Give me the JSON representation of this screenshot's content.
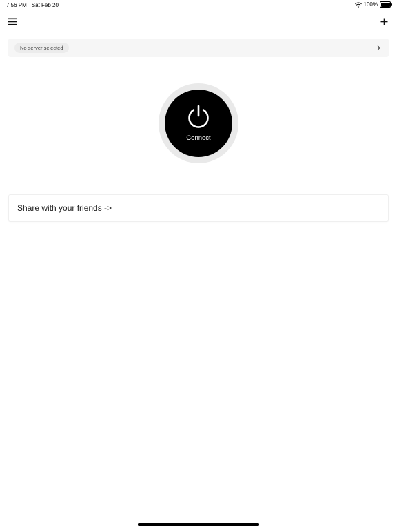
{
  "status_bar": {
    "time": "7:56 PM",
    "date": "Sat Feb 20",
    "battery": "100%",
    "icons": [
      "wifi-icon",
      "battery-icon"
    ]
  },
  "toolbar": {
    "menu_icon": "hamburger-menu-icon",
    "add_icon": "plus-icon"
  },
  "server_selector": {
    "label": "No server selected",
    "chevron_icon": "chevron-right-icon"
  },
  "connect": {
    "icon": "power-icon",
    "label": "Connect"
  },
  "share": {
    "label": "Share with your friends ->"
  },
  "colors": {
    "background": "#ffffff",
    "button": "#000000",
    "ring": "#e9e9e9",
    "bar": "#f6f6f6"
  }
}
